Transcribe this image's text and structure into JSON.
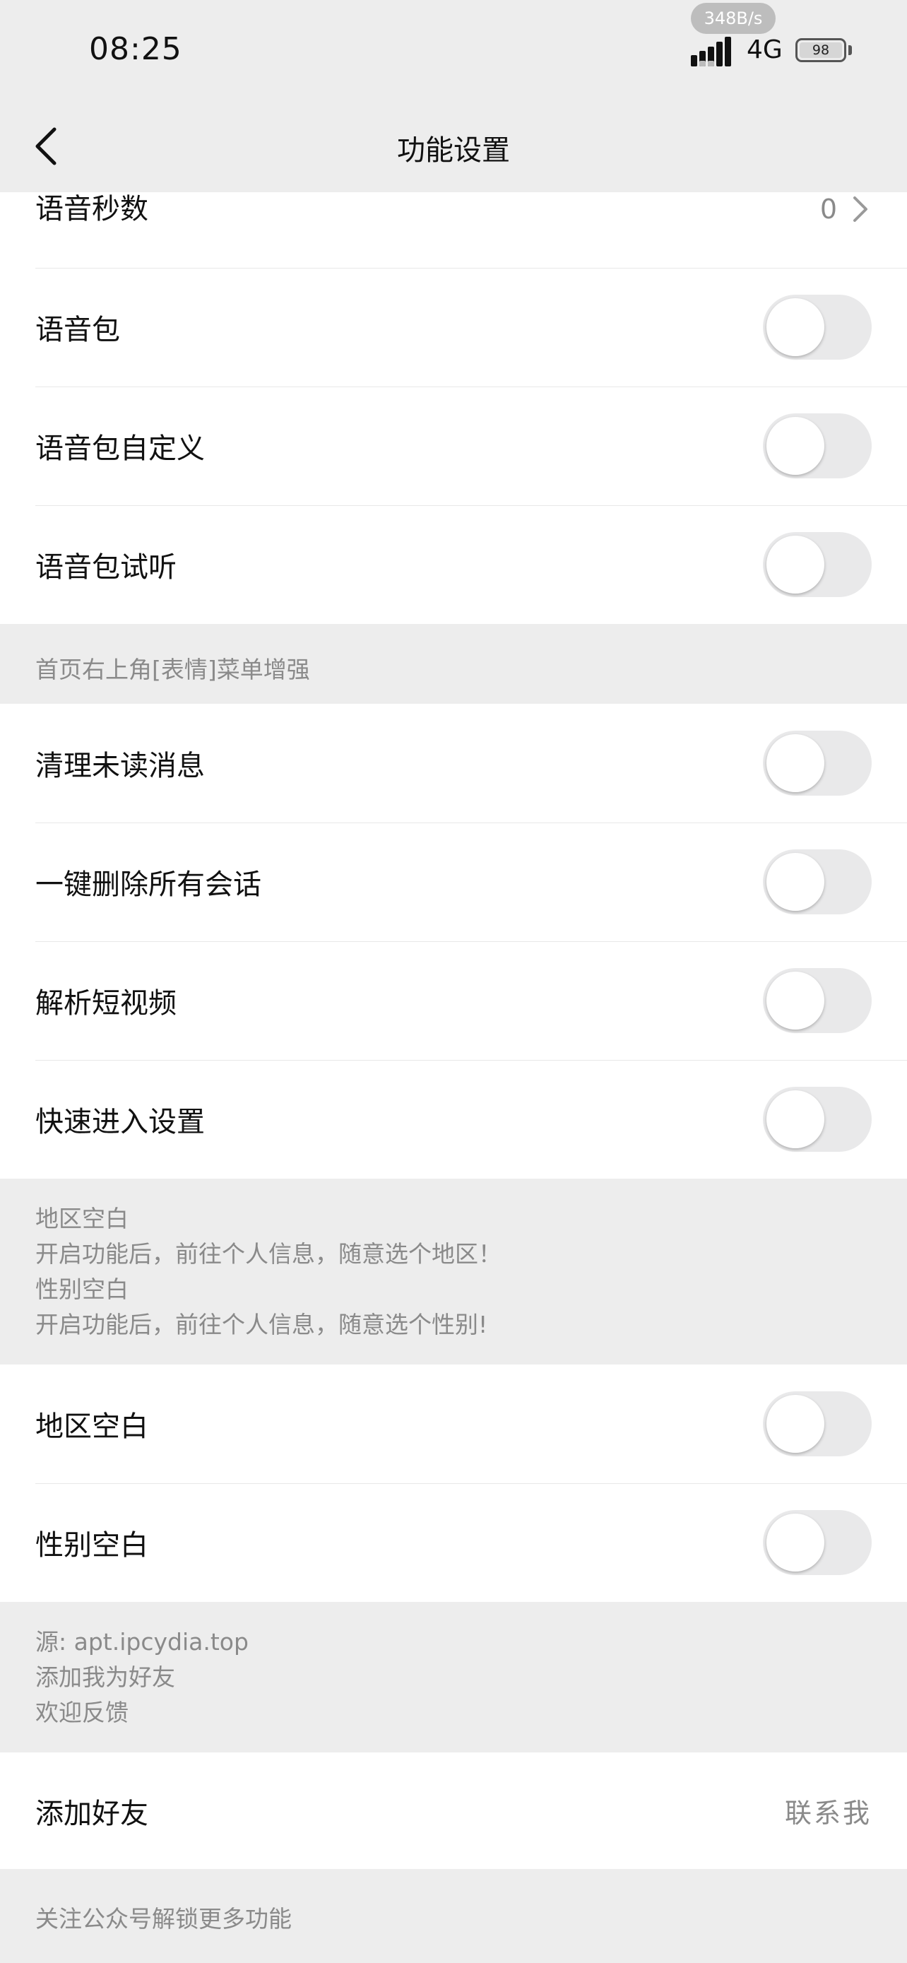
{
  "status_bar": {
    "time": "08:25",
    "net_speed": "348B/s",
    "network": "4G",
    "battery": "98"
  },
  "nav": {
    "title": "功能设置"
  },
  "group_voice": {
    "voice_seconds": {
      "label": "语音秒数",
      "value": "0"
    },
    "voice_pack": {
      "label": "语音包"
    },
    "voice_pack_custom": {
      "label": "语音包自定义"
    },
    "voice_pack_preview": {
      "label": "语音包试听"
    }
  },
  "section_emoji_menu": {
    "header": "首页右上角[表情]菜单增强"
  },
  "group_emoji_menu": {
    "clear_unread": {
      "label": "清理未读消息"
    },
    "delete_all_chats": {
      "label": "一键删除所有会话"
    },
    "parse_short_video": {
      "label": "解析短视频"
    },
    "quick_settings": {
      "label": "快速进入设置"
    }
  },
  "section_blank": {
    "line1": "地区空白",
    "line2": "开启功能后，前往个人信息，随意选个地区！",
    "line3": "性别空白",
    "line4": "开启功能后，前往个人信息，随意选个性别!"
  },
  "group_blank": {
    "region_blank": {
      "label": "地区空白"
    },
    "gender_blank": {
      "label": "性别空白"
    }
  },
  "section_source": {
    "line1": "源: apt.ipcydia.top",
    "line2": "添加我为好友",
    "line3": "欢迎反馈"
  },
  "group_friend": {
    "add_friend": {
      "label": "添加好友",
      "value": "联系我"
    }
  },
  "section_footer": {
    "text": "关注公众号解锁更多功能"
  },
  "colors": {
    "background": "#ededed",
    "card": "#ffffff",
    "secondary_text": "#8a8a8a",
    "toggle_off": "#e9e9ea"
  }
}
